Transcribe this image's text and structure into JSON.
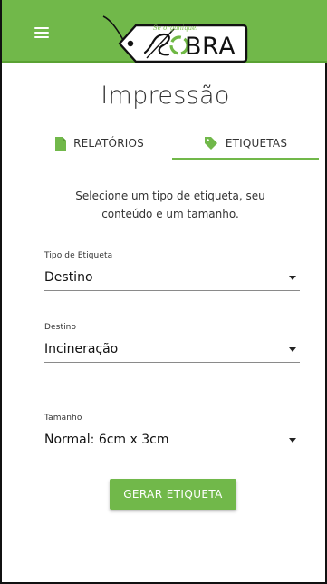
{
  "header": {
    "menu_icon": "hamburger-menu-icon",
    "logo": {
      "script_text": "Se organiquei",
      "word": "BRA",
      "icon": "recycle-tag-icon"
    }
  },
  "page": {
    "title": "Impressão"
  },
  "tabs": [
    {
      "label": "RELATÓRIOS",
      "icon": "file-icon",
      "active": false
    },
    {
      "label": "ETIQUETAS",
      "icon": "tag-icon",
      "active": true
    }
  ],
  "intro_text": "Selecione um tipo de etiqueta, seu conteúdo e um tamanho.",
  "fields": {
    "tipo": {
      "label": "Tipo de Etiqueta",
      "value": "Destino"
    },
    "destino": {
      "label": "Destino",
      "value": "Incineração"
    },
    "tamanho": {
      "label": "Tamanho",
      "value": "Normal: 6cm x 3cm"
    }
  },
  "actions": {
    "generate_label": "GERAR ETIQUETA"
  },
  "colors": {
    "brand_green": "#71b84a",
    "text": "#333333",
    "underline": "#8a8a8a"
  }
}
